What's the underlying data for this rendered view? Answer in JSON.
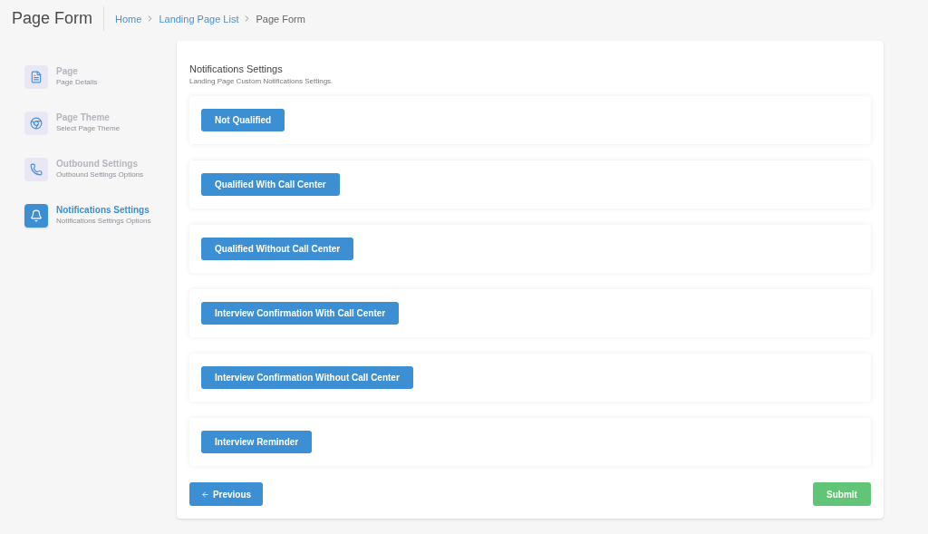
{
  "header": {
    "title": "Page Form",
    "breadcrumb": [
      {
        "label": "Home",
        "link": true
      },
      {
        "label": "Landing Page List",
        "link": true
      },
      {
        "label": "Page Form",
        "link": false
      }
    ]
  },
  "steps": [
    {
      "kind": "file",
      "title": "Page",
      "subtitle": "Page Details",
      "selected": false
    },
    {
      "kind": "theme",
      "title": "Page Theme",
      "subtitle": "Select Page Theme",
      "selected": false
    },
    {
      "kind": "phone",
      "title": "Outbound Settings",
      "subtitle": "Outbound Settings Options",
      "selected": false
    },
    {
      "kind": "bell",
      "title": "Notifications Settings",
      "subtitle": "Notifications Settings Options",
      "selected": true
    }
  ],
  "panel": {
    "title": "Notifications Settings",
    "subtitle": "Landing Page Custom Notifications Settings.",
    "sections": [
      "Not Qualified",
      "Qualified With Call Center",
      "Qualified Without Call Center",
      "Interview Confirmation With Call Center",
      "Interview Confirmation Without Call Center",
      "Interview Reminder"
    ]
  },
  "footer": {
    "previous": "Previous",
    "submit": "Submit"
  }
}
